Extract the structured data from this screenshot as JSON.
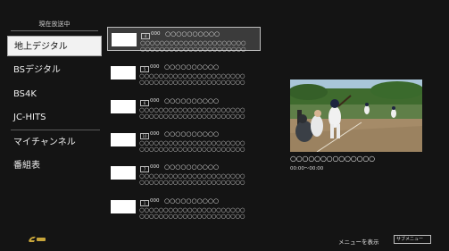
{
  "menu": {
    "header": "現在放送中",
    "items": [
      {
        "label": "地上デジタル"
      },
      {
        "label": "BSデジタル"
      },
      {
        "label": "BS4K"
      },
      {
        "label": "JC-HITS"
      },
      {
        "label": "マイチャンネル"
      },
      {
        "label": "番組表"
      }
    ]
  },
  "channels": [
    {
      "badge": "4",
      "number": "000",
      "title": "○○○○○○○○○○",
      "line1": "○○○○○○○○○○○○○○○○○○○○○○",
      "line2": "○○○○○○○○○○○○○○○○○○○○○○"
    },
    {
      "badge": "5",
      "number": "000",
      "title": "○○○○○○○○○○",
      "line1": "○○○○○○○○○○○○○○○○○○○○○○",
      "line2": "○○○○○○○○○○○○○○○○○○○○○○"
    },
    {
      "badge": "6",
      "number": "000",
      "title": "○○○○○○○○○○",
      "line1": "○○○○○○○○○○○○○○○○○○○○○○",
      "line2": "○○○○○○○○○○○○○○○○○○○○○○"
    },
    {
      "badge": "10",
      "number": "000",
      "title": "○○○○○○○○○○",
      "line1": "○○○○○○○○○○○○○○○○○○○○○○",
      "line2": "○○○○○○○○○○○○○○○○○○○○○○"
    },
    {
      "badge": "7",
      "number": "000",
      "title": "○○○○○○○○○○",
      "line1": "○○○○○○○○○○○○○○○○○○○○○○",
      "line2": "○○○○○○○○○○○○○○○○○○○○○○"
    },
    {
      "badge": "1",
      "number": "000",
      "title": "○○○○○○○○○○",
      "line1": "○○○○○○○○○○○○○○○○○○○○○○",
      "line2": "○○○○○○○○○○○○○○○○○○○○○○"
    }
  ],
  "preview": {
    "title": "○○○○○○○○○○○○○○",
    "time": "00:00〜00:00"
  },
  "footer": {
    "menu_label": "メニューを表示",
    "sub_button": "サブメニュー"
  },
  "colors": {
    "background": "#141414",
    "selected_menu": "#f2f2f2",
    "logo": "#c8a53a"
  }
}
